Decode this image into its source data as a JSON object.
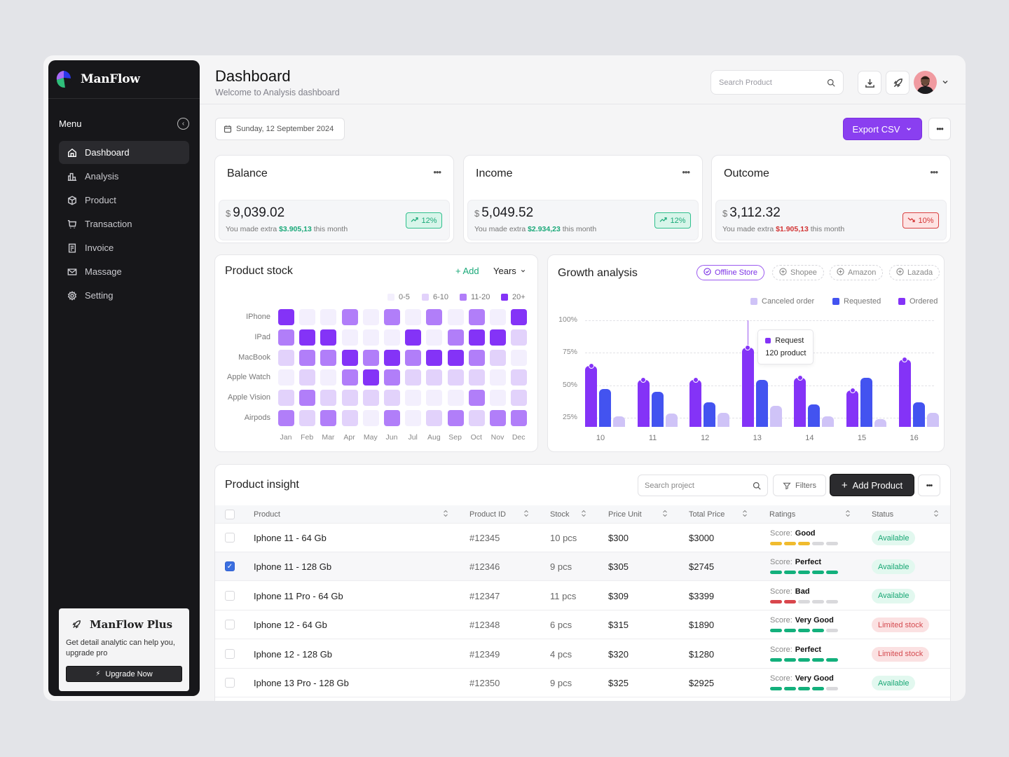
{
  "app": {
    "name": "ManFlow"
  },
  "sidebar": {
    "menu_label": "Menu",
    "items": [
      {
        "label": "Dashboard",
        "icon": "home-icon",
        "active": true
      },
      {
        "label": "Analysis",
        "icon": "bar-chart-icon",
        "active": false
      },
      {
        "label": "Product",
        "icon": "box-icon",
        "active": false
      },
      {
        "label": "Transaction",
        "icon": "cart-icon",
        "active": false
      },
      {
        "label": "Invoice",
        "icon": "invoice-icon",
        "active": false
      },
      {
        "label": "Massage",
        "icon": "mail-icon",
        "active": false
      },
      {
        "label": "Setting",
        "icon": "gear-icon",
        "active": false
      }
    ],
    "promo": {
      "title": "ManFlow Plus",
      "text": "Get detail analytic can help you, upgrade pro",
      "button": "Upgrade Now"
    }
  },
  "header": {
    "title": "Dashboard",
    "subtitle": "Welcome to Analysis dashboard",
    "search_placeholder": "Search Product",
    "date": "Sunday, 12 September 2024",
    "export_label": "Export CSV"
  },
  "stats": [
    {
      "title": "Balance",
      "currency": "$",
      "value": "9,039.02",
      "note_prefix": "You made extra",
      "note_amount": "$3.905,13",
      "note_suffix": "this month",
      "change": "12%",
      "trend": "up"
    },
    {
      "title": "Income",
      "currency": "$",
      "value": "5,049.52",
      "note_prefix": "You made extra",
      "note_amount": "$2.934,23",
      "note_suffix": "this month",
      "change": "12%",
      "trend": "up"
    },
    {
      "title": "Outcome",
      "currency": "$",
      "value": "3,112.32",
      "note_prefix": "You made extra",
      "note_amount": "$1.905,13",
      "note_suffix": "this month",
      "change": "10%",
      "trend": "down"
    }
  ],
  "product_stock": {
    "title": "Product stock",
    "add_label": "+ Add",
    "period_label": "Years"
  },
  "growth": {
    "title": "Growth analysis",
    "channels": [
      {
        "label": "Offline Store",
        "active": true
      },
      {
        "label": "Shopee",
        "active": false
      },
      {
        "label": "Amazon",
        "active": false
      },
      {
        "label": "Lazada",
        "active": false
      }
    ],
    "tooltip": {
      "label": "Request",
      "value": "120 product"
    }
  },
  "chart_data": [
    {
      "type": "heatmap",
      "title": "Product stock",
      "rows": [
        "IPhone",
        "IPad",
        "MacBook",
        "Apple Watch",
        "Apple Vision",
        "Airpods"
      ],
      "columns": [
        "Jan",
        "Feb",
        "Mar",
        "Apr",
        "May",
        "Jun",
        "Jul",
        "Aug",
        "Sep",
        "Oct",
        "Nov",
        "Dec"
      ],
      "legend": [
        "0-5",
        "6-10",
        "11-20",
        "20+"
      ],
      "colors": [
        "#f3effd",
        "#e2d2fb",
        "#b17ef9",
        "#8433f7"
      ],
      "levels": [
        [
          3,
          0,
          0,
          2,
          0,
          2,
          0,
          2,
          0,
          2,
          0,
          3
        ],
        [
          2,
          3,
          3,
          0,
          0,
          0,
          3,
          0,
          2,
          3,
          3,
          1
        ],
        [
          1,
          2,
          2,
          3,
          2,
          3,
          2,
          3,
          3,
          2,
          1,
          0
        ],
        [
          0,
          1,
          0,
          2,
          3,
          2,
          1,
          1,
          1,
          1,
          0,
          1
        ],
        [
          1,
          2,
          1,
          1,
          1,
          1,
          0,
          0,
          0,
          2,
          0,
          1
        ],
        [
          2,
          1,
          2,
          1,
          0,
          2,
          0,
          1,
          2,
          1,
          2,
          2
        ]
      ]
    },
    {
      "type": "bar",
      "title": "Growth analysis",
      "categories": [
        "10",
        "11",
        "12",
        "13",
        "14",
        "15",
        "16"
      ],
      "yticks": [
        "25%",
        "50%",
        "75%",
        "100%"
      ],
      "ylim": [
        18,
        100
      ],
      "series": [
        {
          "name": "Ordered",
          "color": "#8433f7",
          "values": [
            65,
            54,
            54,
            79,
            56,
            46,
            70
          ]
        },
        {
          "name": "Requested",
          "color": "#4353f0",
          "values": [
            47,
            45,
            37,
            54,
            35,
            56,
            37
          ]
        },
        {
          "name": "Canceled order",
          "color": "#cfc3f7",
          "values": [
            26,
            28,
            29,
            34,
            26,
            24,
            29
          ]
        }
      ],
      "legend_order": [
        "Canceled order",
        "Requested",
        "Ordered"
      ],
      "highlight_index": 3
    }
  ],
  "insight": {
    "title": "Product insight",
    "search_placeholder": "Search project",
    "filters_label": "Filters",
    "add_label": "Add Product",
    "columns": [
      "Product",
      "Product ID",
      "Stock",
      "Price Unit",
      "Total Price",
      "Ratings",
      "Status"
    ],
    "score_label": "Score:",
    "rows": [
      {
        "product": "Iphone 11 - 64 Gb",
        "id": "#12345",
        "stock": "10 pcs",
        "price": "$300",
        "total": "$3000",
        "rating": "Good",
        "score": 3,
        "color": "#f0bb2e",
        "status": "Available",
        "status_type": "ok",
        "checked": false
      },
      {
        "product": "Iphone 11 - 128 Gb",
        "id": "#12346",
        "stock": "9 pcs",
        "price": "$305",
        "total": "$2745",
        "rating": "Perfect",
        "score": 5,
        "color": "#13b07c",
        "status": "Available",
        "status_type": "ok",
        "checked": true
      },
      {
        "product": "Iphone 11 Pro - 64 Gb",
        "id": "#12347",
        "stock": "11 pcs",
        "price": "$309",
        "total": "$3399",
        "rating": "Bad",
        "score": 2,
        "color": "#d9464c",
        "status": "Available",
        "status_type": "ok",
        "checked": false
      },
      {
        "product": "Iphone 12  - 64 Gb",
        "id": "#12348",
        "stock": "6 pcs",
        "price": "$315",
        "total": "$1890",
        "rating": "Very Good",
        "score": 4,
        "color": "#13b07c",
        "status": "Limited stock",
        "status_type": "lim",
        "checked": false
      },
      {
        "product": "Iphone 12  - 128 Gb",
        "id": "#12349",
        "stock": "4 pcs",
        "price": "$320",
        "total": "$1280",
        "rating": "Perfect",
        "score": 5,
        "color": "#13b07c",
        "status": "Limited stock",
        "status_type": "lim",
        "checked": false
      },
      {
        "product": "Iphone 13 Pro - 128 Gb",
        "id": "#12350",
        "stock": "9 pcs",
        "price": "$325",
        "total": "$2925",
        "rating": "Very Good",
        "score": 4,
        "color": "#13b07c",
        "status": "Available",
        "status_type": "ok",
        "checked": false
      }
    ]
  },
  "colors": {
    "accent": "#8a3ff0",
    "success": "#1ba979",
    "danger": "#d23434",
    "sidebar_bg": "#17171a"
  }
}
